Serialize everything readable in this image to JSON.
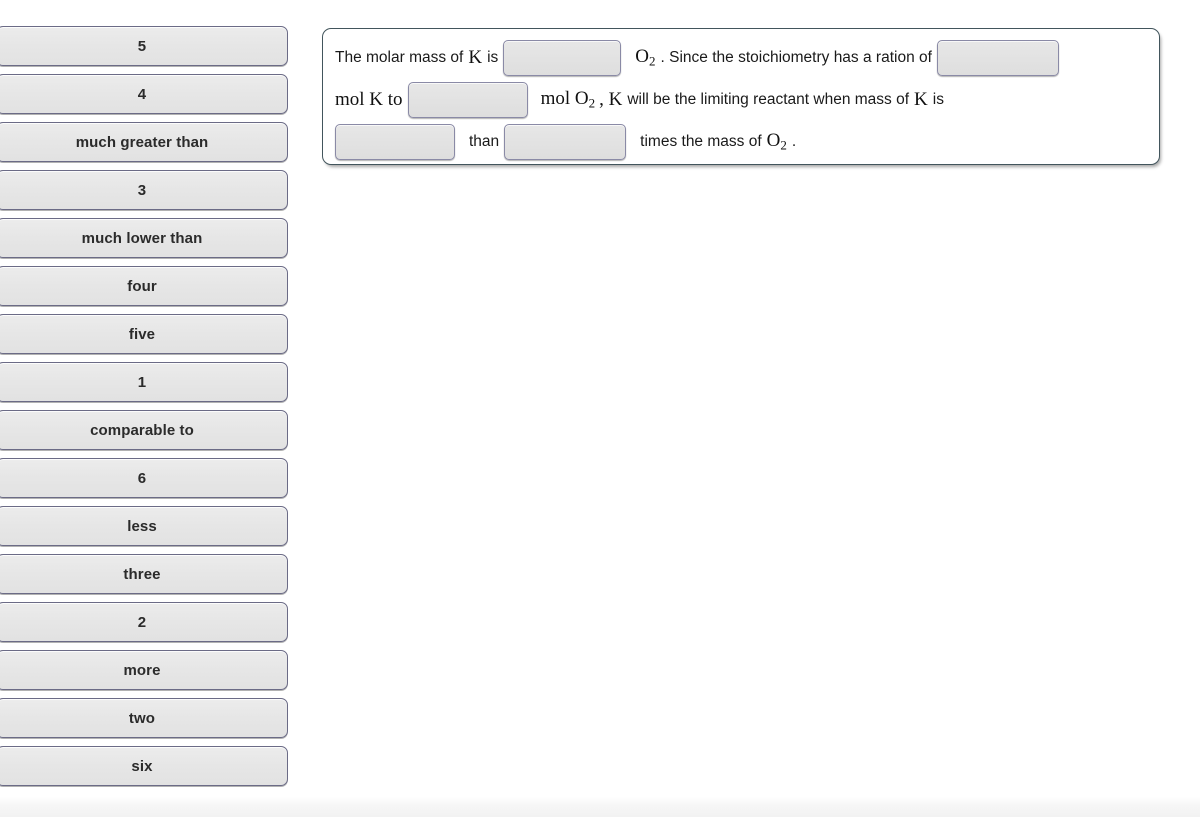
{
  "answer_bank": {
    "items": [
      {
        "label": "5"
      },
      {
        "label": "4"
      },
      {
        "label": "much greater than"
      },
      {
        "label": "3"
      },
      {
        "label": "much lower than"
      },
      {
        "label": "four"
      },
      {
        "label": "five"
      },
      {
        "label": "1"
      },
      {
        "label": "comparable to"
      },
      {
        "label": "6"
      },
      {
        "label": "less"
      },
      {
        "label": "three"
      },
      {
        "label": "2"
      },
      {
        "label": "more"
      },
      {
        "label": "two"
      },
      {
        "label": "six"
      }
    ]
  },
  "question": {
    "line1": {
      "text_before": "The molar mass of",
      "element_k": "K",
      "text_is": "is",
      "blank1_value": "",
      "formula_o2": "O",
      "formula_o2_sub": "2",
      "text_after": ". Since the stoichiometry has a ration of",
      "blank2_value": ""
    },
    "line2": {
      "text_mol_k_to": "mol K to",
      "blank3_value": "",
      "text_mol_o2": "mol O",
      "text_mol_o2_sub": "2",
      "text_comma_k": ", K",
      "text_rest": "will be the limiting reactant when mass of",
      "element_k": "K",
      "text_is": "is"
    },
    "line3": {
      "blank4_value": "",
      "text_than": "than",
      "blank5_value": "",
      "text_times": "times the mass of",
      "formula_o2": "O",
      "formula_o2_sub": "2",
      "text_period": "."
    }
  },
  "colors": {
    "frame_border": "#42555c",
    "blank_border": "#8a8aa6",
    "bank_border": "#6b6b86",
    "bank_fill": "#e8e8e8",
    "text": "#1a1a1a"
  }
}
